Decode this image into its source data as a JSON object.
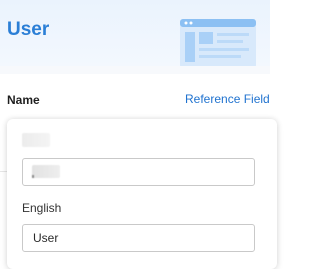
{
  "header": {
    "title": "User",
    "illustration_icon": "form-document-illustration"
  },
  "field_row": {
    "name_label": "Name",
    "reference_link": "Reference Field"
  },
  "translation_popup": {
    "default_language_label": "",
    "default_value": "",
    "english_label": "English",
    "english_value": "User"
  },
  "colors": {
    "accent": "#2b7fd6",
    "link": "#1f72cf",
    "header_bg": "#eaf3fd"
  }
}
